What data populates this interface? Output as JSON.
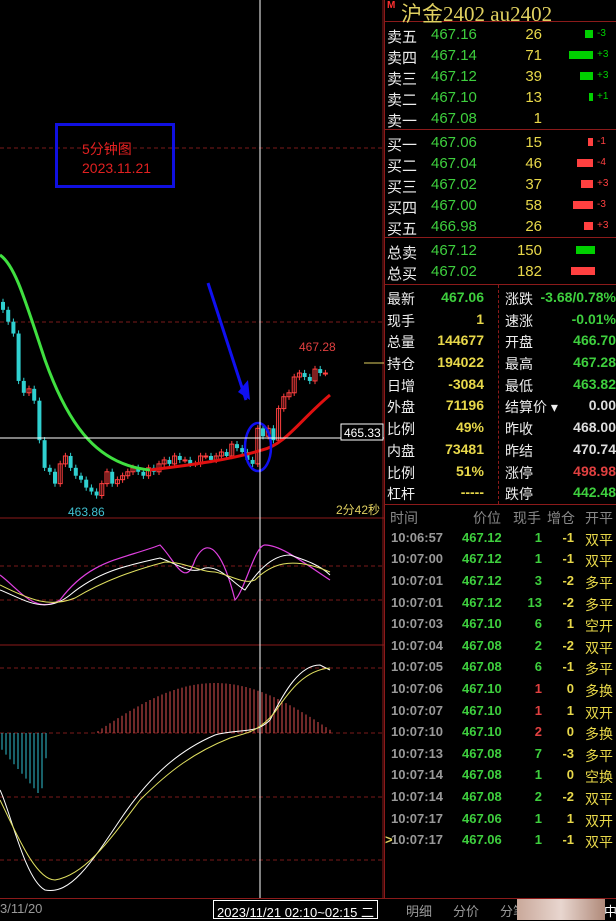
{
  "header": {
    "badge": "M",
    "title": "沪金2402  au2402"
  },
  "orderbook": {
    "asks": [
      {
        "label": "卖五",
        "price": "467.16",
        "vol": "26",
        "delta": "-3",
        "bar": 0.33
      },
      {
        "label": "卖四",
        "price": "467.14",
        "vol": "71",
        "delta": "+3",
        "bar": 1.0
      },
      {
        "label": "卖三",
        "price": "467.12",
        "vol": "39",
        "delta": "+3",
        "bar": 0.55
      },
      {
        "label": "卖二",
        "price": "467.10",
        "vol": "13",
        "delta": "+1",
        "bar": 0.18
      },
      {
        "label": "卖一",
        "price": "467.08",
        "vol": "1",
        "delta": "",
        "bar": 0
      }
    ],
    "bids": [
      {
        "label": "买一",
        "price": "467.06",
        "vol": "15",
        "delta": "-1",
        "bar": 0.22
      },
      {
        "label": "买二",
        "price": "467.04",
        "vol": "46",
        "delta": "-4",
        "bar": 0.65
      },
      {
        "label": "买三",
        "price": "467.02",
        "vol": "37",
        "delta": "+3",
        "bar": 0.52
      },
      {
        "label": "买四",
        "price": "467.00",
        "vol": "58",
        "delta": "-3",
        "bar": 0.82
      },
      {
        "label": "买五",
        "price": "466.98",
        "vol": "26",
        "delta": "+3",
        "bar": 0.37
      }
    ],
    "totals": [
      {
        "label": "总卖",
        "price": "467.12",
        "vol": "150",
        "bar": 0.8,
        "color": "#00d000"
      },
      {
        "label": "总买",
        "price": "467.02",
        "vol": "182",
        "bar": 1.0,
        "color": "#ff4040"
      }
    ]
  },
  "stats": [
    {
      "l1": "最新",
      "v1": "467.06",
      "l2": "涨跌",
      "v2": "-3.68/0.78%",
      "c2": "#3ecf3e"
    },
    {
      "l1": "现手",
      "v1": "1",
      "l2": "速涨",
      "v2": "-0.01%",
      "c2": "#3ecf3e"
    },
    {
      "l1": "总量",
      "v1": "144677",
      "l2": "开盘",
      "v2": "466.70",
      "c2": "#3ecf3e"
    },
    {
      "l1": "持仓",
      "v1": "194022",
      "l2": "最高",
      "v2": "467.28",
      "c2": "#3ecf3e"
    },
    {
      "l1": "日增",
      "v1": "-3084",
      "l2": "最低",
      "v2": "463.82",
      "c2": "#3ecf3e"
    },
    {
      "l1": "外盘",
      "v1": "71196",
      "l2": "结算价 ▾",
      "v2": "0.00",
      "c2": "#ddd"
    },
    {
      "l1": "比例",
      "v1": "49%",
      "l2": "昨收",
      "v2": "468.00",
      "c2": "#ddd"
    },
    {
      "l1": "内盘",
      "v1": "73481",
      "l2": "昨结",
      "v2": "470.74",
      "c2": "#ddd"
    },
    {
      "l1": "比例",
      "v1": "51%",
      "l2": "涨停",
      "v2": "498.98",
      "c2": "#e04040"
    },
    {
      "l1": "杠杆",
      "v1": "-----",
      "l2": "跌停",
      "v2": "442.48",
      "c2": "#3ecf3e"
    }
  ],
  "trades_header": {
    "time": "时间",
    "price": "价位",
    "qty": "现手",
    "oi": "增仓",
    "type": "开平"
  },
  "trades": [
    {
      "time": "10:06:57",
      "price": "467.12",
      "qty": "1",
      "oi": "-1",
      "type": "双平",
      "up": false
    },
    {
      "time": "10:07:00",
      "price": "467.12",
      "qty": "1",
      "oi": "-1",
      "type": "双平",
      "up": false
    },
    {
      "time": "10:07:01",
      "price": "467.12",
      "qty": "3",
      "oi": "-2",
      "type": "多平",
      "up": false
    },
    {
      "time": "10:07:01",
      "price": "467.12",
      "qty": "13",
      "oi": "-2",
      "type": "多平",
      "up": false
    },
    {
      "time": "10:07:03",
      "price": "467.10",
      "qty": "6",
      "oi": "1",
      "type": "空开",
      "up": false
    },
    {
      "time": "10:07:04",
      "price": "467.08",
      "qty": "2",
      "oi": "-2",
      "type": "双平",
      "up": false
    },
    {
      "time": "10:07:05",
      "price": "467.08",
      "qty": "6",
      "oi": "-1",
      "type": "多平",
      "up": false
    },
    {
      "time": "10:07:06",
      "price": "467.10",
      "qty": "1",
      "oi": "0",
      "type": "多换",
      "up": true
    },
    {
      "time": "10:07:07",
      "price": "467.10",
      "qty": "1",
      "oi": "1",
      "type": "双开",
      "up": true
    },
    {
      "time": "10:07:10",
      "price": "467.10",
      "qty": "2",
      "oi": "0",
      "type": "多换",
      "up": true
    },
    {
      "time": "10:07:13",
      "price": "467.08",
      "qty": "7",
      "oi": "-3",
      "type": "多平",
      "up": false
    },
    {
      "time": "10:07:14",
      "price": "467.08",
      "qty": "1",
      "oi": "0",
      "type": "空换",
      "up": false
    },
    {
      "time": "10:07:14",
      "price": "467.08",
      "qty": "2",
      "oi": "-2",
      "type": "双平",
      "up": false
    },
    {
      "time": "10:07:17",
      "price": "467.06",
      "qty": "1",
      "oi": "1",
      "type": "双开",
      "up": false
    },
    {
      "time": "10:07:17",
      "price": "467.06",
      "qty": "1",
      "oi": "-1",
      "type": "双平",
      "up": false
    }
  ],
  "trades_marker": ">",
  "chart": {
    "note_title": "5分钟图",
    "note_date": "2023.11.21",
    "high_label": "467.28",
    "low_label": "463.86",
    "cursor_price": "465.33",
    "countdown": "2分42秒",
    "closes": [
      468.6,
      468.3,
      468.0,
      466.8,
      466.5,
      466.6,
      466.3,
      465.3,
      464.6,
      464.5,
      464.2,
      464.7,
      464.9,
      464.6,
      464.4,
      464.3,
      464.1,
      464.0,
      463.9,
      464.2,
      464.5,
      464.2,
      464.3,
      464.4,
      464.5,
      464.6,
      464.5,
      464.4,
      464.6,
      464.5,
      464.7,
      464.8,
      464.7,
      464.9,
      464.8,
      464.8,
      464.7,
      464.7,
      464.9,
      464.9,
      464.8,
      464.9,
      465.0,
      464.9,
      465.2,
      465.1,
      465.0,
      464.8,
      464.7,
      465.6,
      465.4,
      465.6,
      465.3,
      466.1,
      466.4,
      466.5,
      466.9,
      467.0,
      466.9,
      466.8,
      467.1,
      467.0,
      467.0
    ],
    "price_range": [
      463.5,
      469.5
    ],
    "accent": {
      "up": "#ff4040",
      "down": "#30d0d0",
      "ma_fast": "#40e040",
      "ma_slow": "#e01010"
    }
  },
  "bottom": {
    "date_left": "3/11/20",
    "range": "2023/11/21 02:10~02:15 二",
    "tabs": [
      "明细",
      "分价",
      "分笔"
    ],
    "corner": "中"
  }
}
